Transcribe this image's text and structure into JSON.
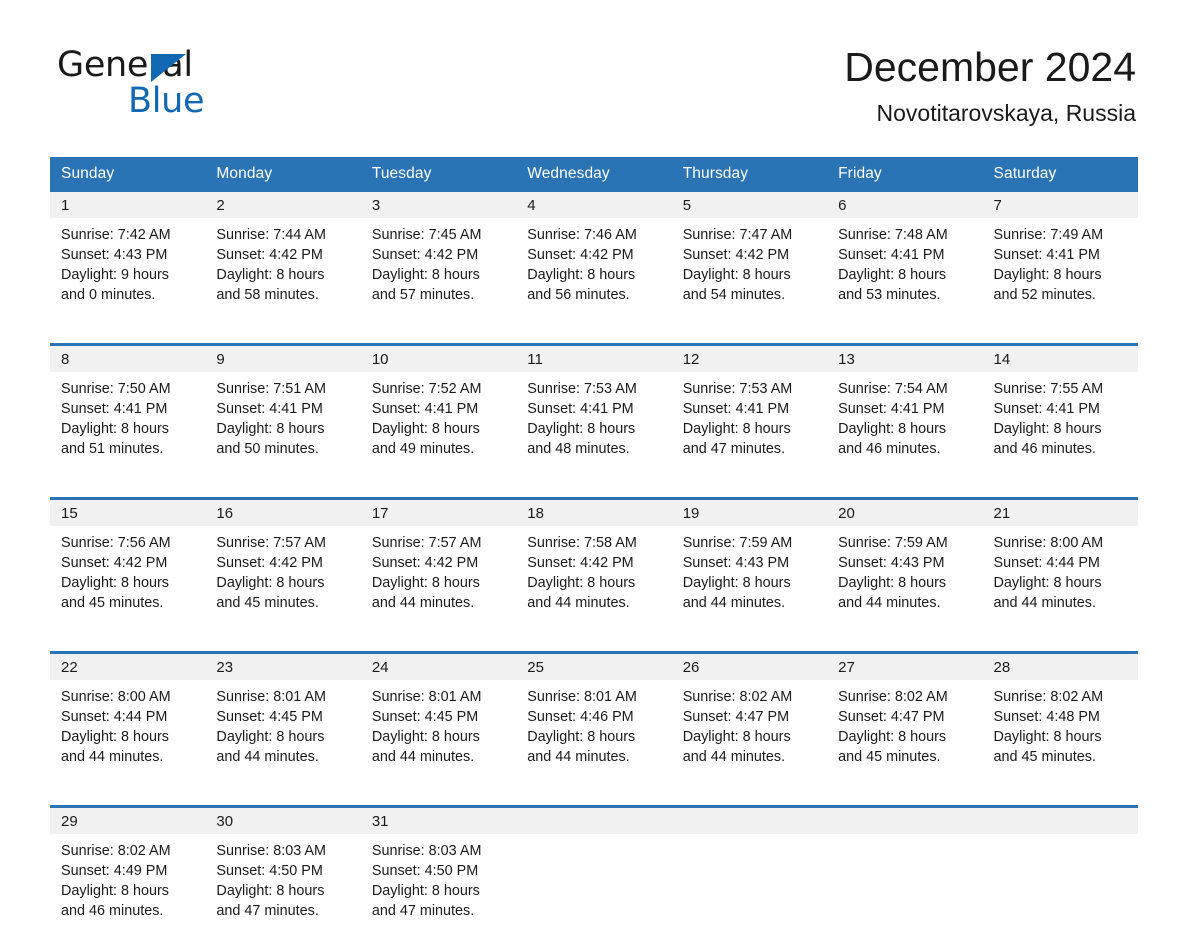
{
  "brand": {
    "line1": "General",
    "line2": "Blue",
    "triangle_color": "#1268b3"
  },
  "header": {
    "title": "December 2024",
    "subtitle": "Novotitarovskaya, Russia"
  },
  "theme": {
    "header_blue": "#2a74b5",
    "daynum_gray": "#f1f1f1",
    "text": "#1a1a1a"
  },
  "calendar": {
    "weekday_headers": [
      "Sunday",
      "Monday",
      "Tuesday",
      "Wednesday",
      "Thursday",
      "Friday",
      "Saturday"
    ],
    "weeks": [
      [
        {
          "day": "1",
          "details": "Sunrise: 7:42 AM\nSunset: 4:43 PM\nDaylight: 9 hours\nand 0 minutes."
        },
        {
          "day": "2",
          "details": "Sunrise: 7:44 AM\nSunset: 4:42 PM\nDaylight: 8 hours\nand 58 minutes."
        },
        {
          "day": "3",
          "details": "Sunrise: 7:45 AM\nSunset: 4:42 PM\nDaylight: 8 hours\nand 57 minutes."
        },
        {
          "day": "4",
          "details": "Sunrise: 7:46 AM\nSunset: 4:42 PM\nDaylight: 8 hours\nand 56 minutes."
        },
        {
          "day": "5",
          "details": "Sunrise: 7:47 AM\nSunset: 4:42 PM\nDaylight: 8 hours\nand 54 minutes."
        },
        {
          "day": "6",
          "details": "Sunrise: 7:48 AM\nSunset: 4:41 PM\nDaylight: 8 hours\nand 53 minutes."
        },
        {
          "day": "7",
          "details": "Sunrise: 7:49 AM\nSunset: 4:41 PM\nDaylight: 8 hours\nand 52 minutes."
        }
      ],
      [
        {
          "day": "8",
          "details": "Sunrise: 7:50 AM\nSunset: 4:41 PM\nDaylight: 8 hours\nand 51 minutes."
        },
        {
          "day": "9",
          "details": "Sunrise: 7:51 AM\nSunset: 4:41 PM\nDaylight: 8 hours\nand 50 minutes."
        },
        {
          "day": "10",
          "details": "Sunrise: 7:52 AM\nSunset: 4:41 PM\nDaylight: 8 hours\nand 49 minutes."
        },
        {
          "day": "11",
          "details": "Sunrise: 7:53 AM\nSunset: 4:41 PM\nDaylight: 8 hours\nand 48 minutes."
        },
        {
          "day": "12",
          "details": "Sunrise: 7:53 AM\nSunset: 4:41 PM\nDaylight: 8 hours\nand 47 minutes."
        },
        {
          "day": "13",
          "details": "Sunrise: 7:54 AM\nSunset: 4:41 PM\nDaylight: 8 hours\nand 46 minutes."
        },
        {
          "day": "14",
          "details": "Sunrise: 7:55 AM\nSunset: 4:41 PM\nDaylight: 8 hours\nand 46 minutes."
        }
      ],
      [
        {
          "day": "15",
          "details": "Sunrise: 7:56 AM\nSunset: 4:42 PM\nDaylight: 8 hours\nand 45 minutes."
        },
        {
          "day": "16",
          "details": "Sunrise: 7:57 AM\nSunset: 4:42 PM\nDaylight: 8 hours\nand 45 minutes."
        },
        {
          "day": "17",
          "details": "Sunrise: 7:57 AM\nSunset: 4:42 PM\nDaylight: 8 hours\nand 44 minutes."
        },
        {
          "day": "18",
          "details": "Sunrise: 7:58 AM\nSunset: 4:42 PM\nDaylight: 8 hours\nand 44 minutes."
        },
        {
          "day": "19",
          "details": "Sunrise: 7:59 AM\nSunset: 4:43 PM\nDaylight: 8 hours\nand 44 minutes."
        },
        {
          "day": "20",
          "details": "Sunrise: 7:59 AM\nSunset: 4:43 PM\nDaylight: 8 hours\nand 44 minutes."
        },
        {
          "day": "21",
          "details": "Sunrise: 8:00 AM\nSunset: 4:44 PM\nDaylight: 8 hours\nand 44 minutes."
        }
      ],
      [
        {
          "day": "22",
          "details": "Sunrise: 8:00 AM\nSunset: 4:44 PM\nDaylight: 8 hours\nand 44 minutes."
        },
        {
          "day": "23",
          "details": "Sunrise: 8:01 AM\nSunset: 4:45 PM\nDaylight: 8 hours\nand 44 minutes."
        },
        {
          "day": "24",
          "details": "Sunrise: 8:01 AM\nSunset: 4:45 PM\nDaylight: 8 hours\nand 44 minutes."
        },
        {
          "day": "25",
          "details": "Sunrise: 8:01 AM\nSunset: 4:46 PM\nDaylight: 8 hours\nand 44 minutes."
        },
        {
          "day": "26",
          "details": "Sunrise: 8:02 AM\nSunset: 4:47 PM\nDaylight: 8 hours\nand 44 minutes."
        },
        {
          "day": "27",
          "details": "Sunrise: 8:02 AM\nSunset: 4:47 PM\nDaylight: 8 hours\nand 45 minutes."
        },
        {
          "day": "28",
          "details": "Sunrise: 8:02 AM\nSunset: 4:48 PM\nDaylight: 8 hours\nand 45 minutes."
        }
      ],
      [
        {
          "day": "29",
          "details": "Sunrise: 8:02 AM\nSunset: 4:49 PM\nDaylight: 8 hours\nand 46 minutes."
        },
        {
          "day": "30",
          "details": "Sunrise: 8:03 AM\nSunset: 4:50 PM\nDaylight: 8 hours\nand 47 minutes."
        },
        {
          "day": "31",
          "details": "Sunrise: 8:03 AM\nSunset: 4:50 PM\nDaylight: 8 hours\nand 47 minutes."
        },
        {
          "day": "",
          "details": ""
        },
        {
          "day": "",
          "details": ""
        },
        {
          "day": "",
          "details": ""
        },
        {
          "day": "",
          "details": ""
        }
      ]
    ]
  }
}
